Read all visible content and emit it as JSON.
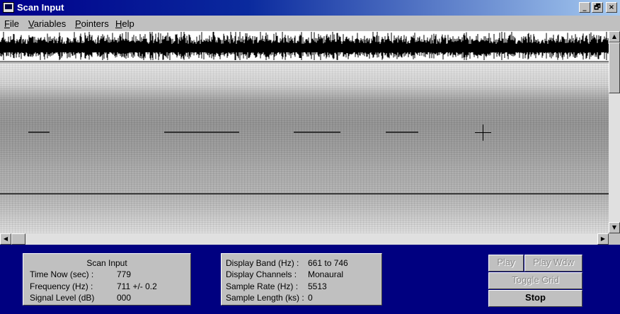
{
  "window": {
    "title": "Scan Input",
    "controls": {
      "minimize": "_",
      "maximize": "🗗",
      "close": "×"
    }
  },
  "menu": [
    {
      "label": "File",
      "key": "F",
      "rest": "ile"
    },
    {
      "label": "Variables",
      "key": "V",
      "rest": "ariables"
    },
    {
      "label": "Pointers",
      "key": "P",
      "rest": "ointers"
    },
    {
      "label": "Help",
      "key": "H",
      "rest": "elp"
    }
  ],
  "scan_panel": {
    "header": "Scan Input",
    "rows": [
      {
        "label": "Time Now (sec) :",
        "value": "779"
      },
      {
        "label": "Frequency (Hz) :",
        "value": "711 +/- 0.2"
      },
      {
        "label": "Signal Level (dB)",
        "value": "000"
      }
    ]
  },
  "display_panel": {
    "rows": [
      {
        "label": "Display Band (Hz) :",
        "value": "661 to 746"
      },
      {
        "label": "Display Channels :",
        "value": "Monaural"
      },
      {
        "label": "Sample Rate (Hz) :",
        "value": "5513"
      },
      {
        "label": "Sample Length (ks) :",
        "value": "0"
      }
    ]
  },
  "buttons": {
    "play": "Play",
    "play_window": "Play Wdw",
    "toggle_grid": "Toggle Grid",
    "stop": "Stop"
  },
  "icons": {
    "scroll_up": "▲",
    "scroll_down": "▼",
    "scroll_left": "◀",
    "scroll_right": "▶"
  }
}
